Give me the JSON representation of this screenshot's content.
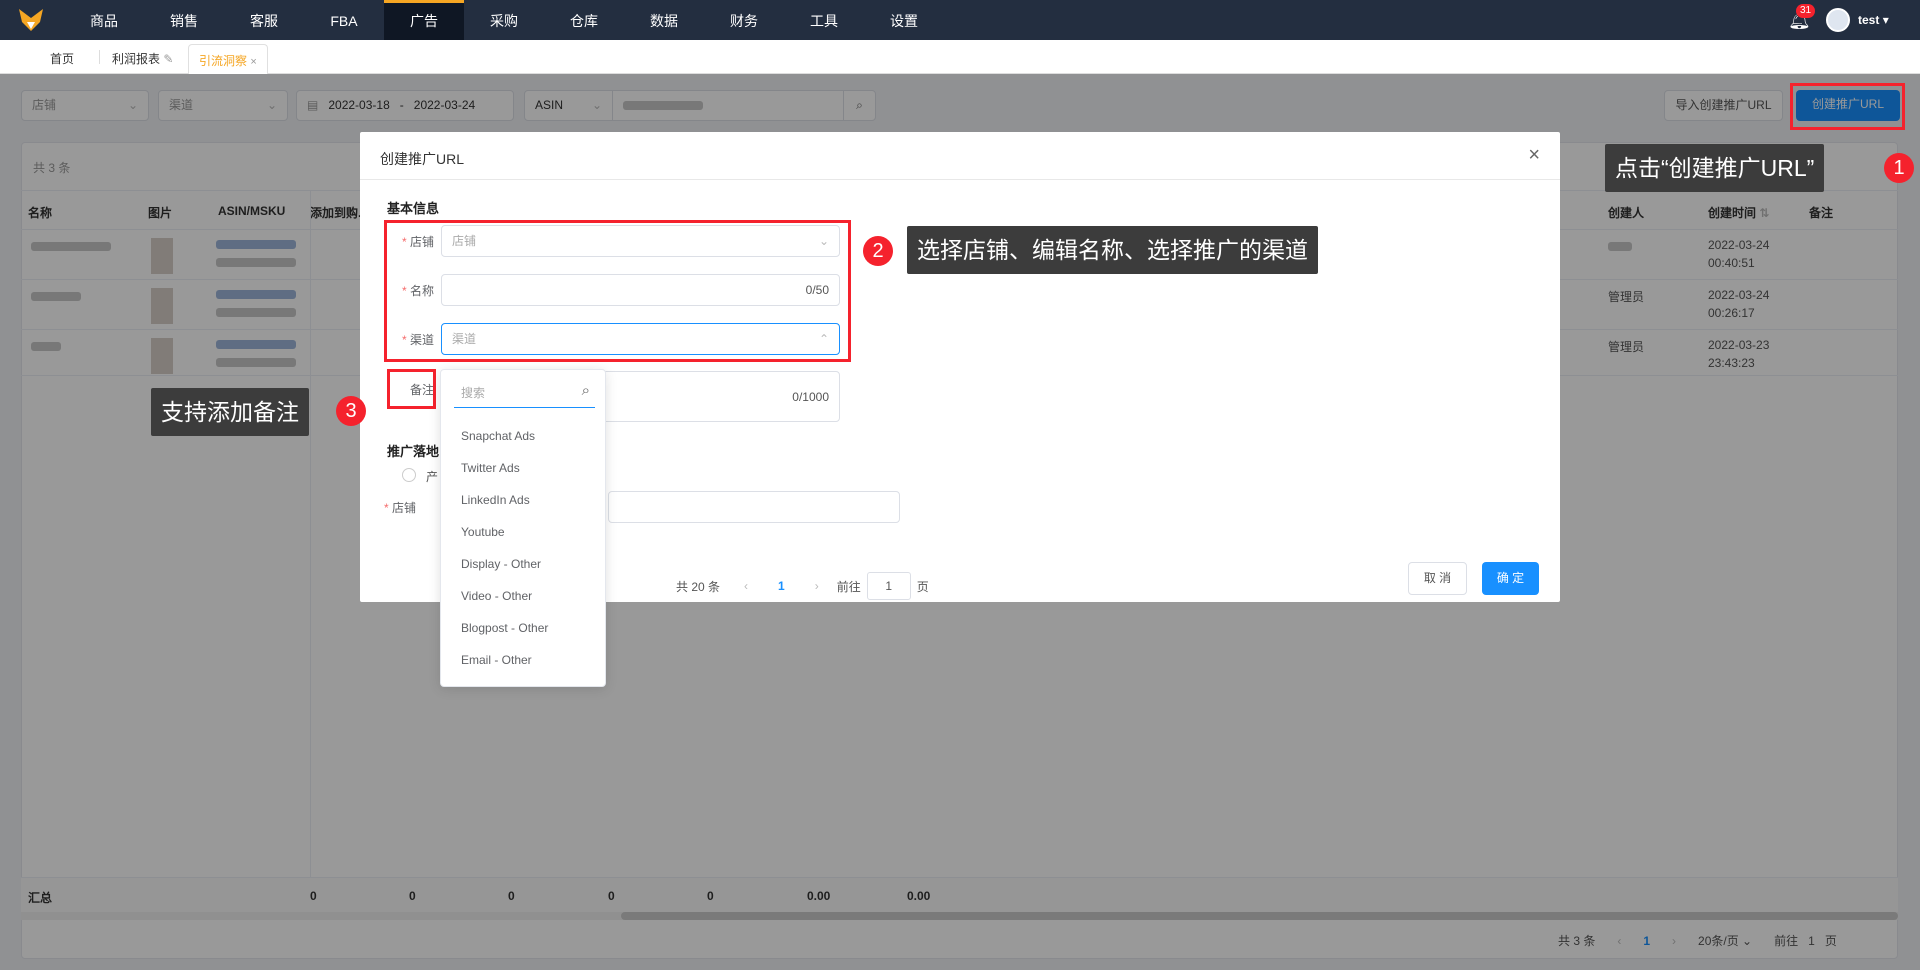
{
  "nav": {
    "items": [
      "商品",
      "销售",
      "客服",
      "FBA",
      "广告",
      "采购",
      "仓库",
      "数据",
      "财务",
      "工具",
      "设置"
    ],
    "active": "广告",
    "notifications": "31",
    "user": "test",
    "accent": "#f5a623"
  },
  "tabs": [
    {
      "label": "首页"
    },
    {
      "label": "利润报表"
    },
    {
      "label": "引流洞察"
    }
  ],
  "filters": {
    "store": "店铺",
    "channel": "渠道",
    "date_start": "2022-03-18",
    "date_sep": "-",
    "date_end": "2022-03-24",
    "search_type": "ASIN",
    "import_btn": "导入创建推广URL",
    "create_btn": "创建推广URL"
  },
  "table": {
    "count": "共 3 条",
    "headers": [
      "名称",
      "图片",
      "ASIN/MSKU",
      "添加到购...",
      "创建人",
      "创建时间",
      "备注"
    ],
    "rows": [
      {
        "creator": "",
        "created": [
          "2022-03-24",
          "00:40:51"
        ]
      },
      {
        "creator": "管理员",
        "created": [
          "2022-03-24",
          "00:26:17"
        ]
      },
      {
        "creator": "管理员",
        "created": [
          "2022-03-23",
          "23:43:23"
        ]
      }
    ],
    "summary": {
      "label": "汇总",
      "values": [
        "0",
        "0",
        "0",
        "0",
        "0",
        "0.00",
        "0.00"
      ]
    },
    "pagination": {
      "total": "共 3 条",
      "page": "1",
      "size": "20条/页",
      "goto": "前往",
      "goto_value": "1",
      "page_unit": "页"
    }
  },
  "dialog": {
    "title": "创建推广URL",
    "section_basic": "基本信息",
    "store_label": "店铺",
    "store_placeholder": "店铺",
    "name_label": "名称",
    "name_count": "0/50",
    "channel_label": "渠道",
    "channel_placeholder": "渠道",
    "remark_label": "备注",
    "remark_count": "0/1000",
    "section_landing": "推广落地",
    "radio_label": "产",
    "landing_store_label": "店铺",
    "pagination": {
      "total": "共 20 条",
      "page": "1",
      "goto": "前往",
      "goto_value": "1",
      "page_unit": "页"
    },
    "cancel": "取 消",
    "ok": "确 定",
    "primary_color": "#1890ff"
  },
  "dropdown": {
    "search_placeholder": "搜索",
    "options": [
      "Snapchat Ads",
      "Twitter Ads",
      "LinkedIn Ads",
      "Youtube",
      "Display - Other",
      "Video - Other",
      "Blogpost - Other",
      "Email - Other"
    ]
  },
  "callouts": [
    {
      "num": "1",
      "text": "点击“创建推广URL”"
    },
    {
      "num": "2",
      "text": "选择店铺、编辑名称、选择推广的渠道"
    },
    {
      "num": "3",
      "text": "支持添加备注"
    }
  ]
}
